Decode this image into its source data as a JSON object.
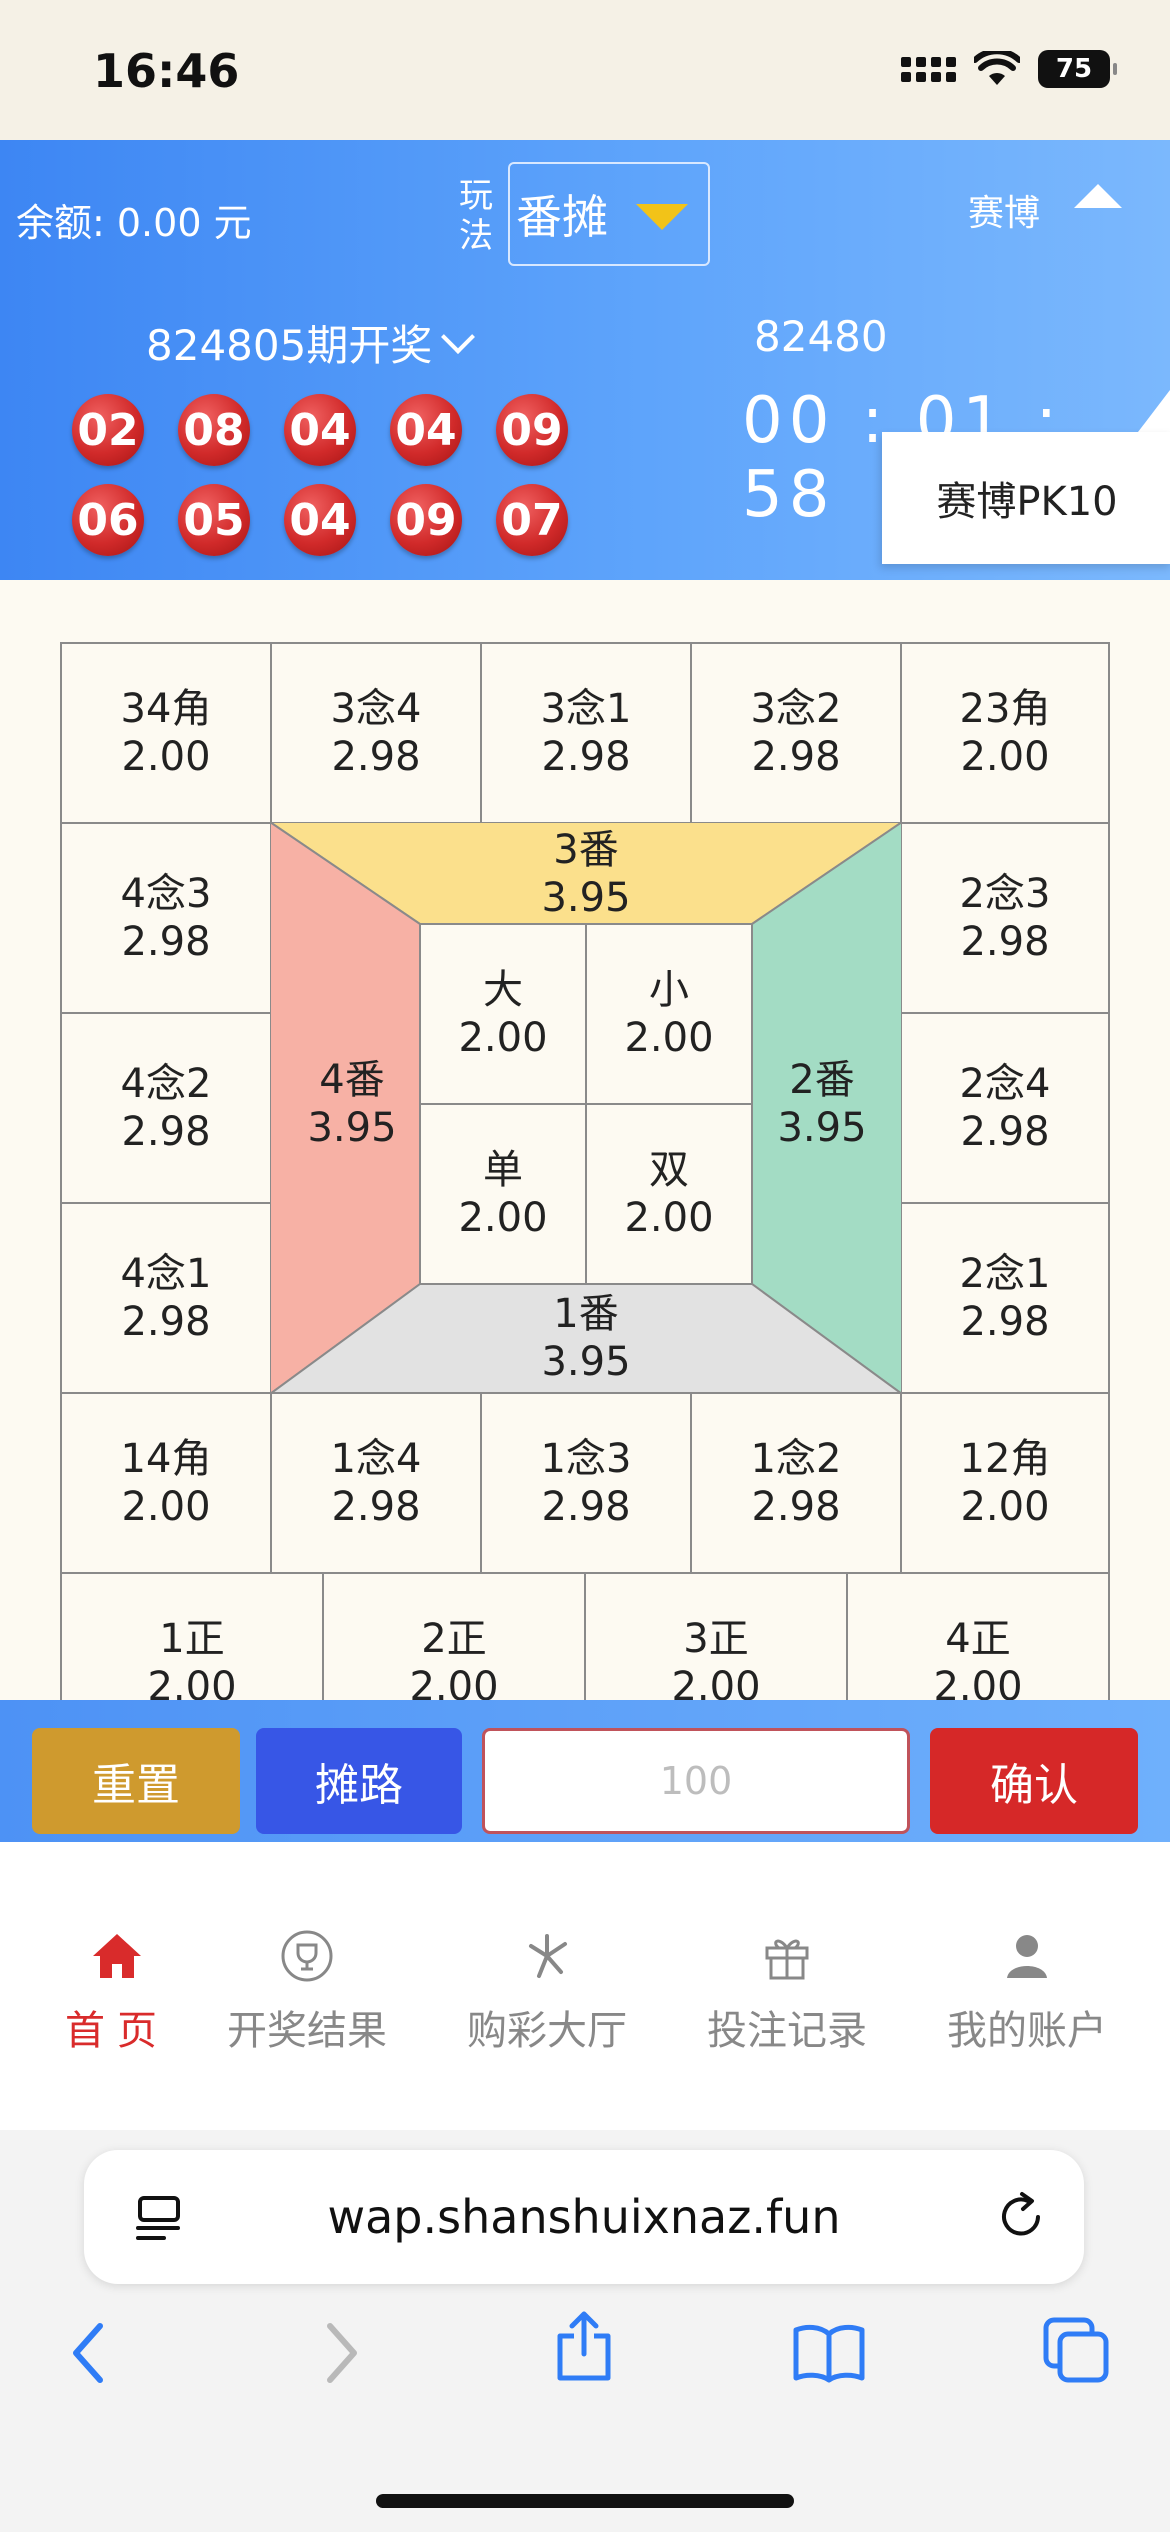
{
  "status_bar": {
    "time": "16:46",
    "battery": "75"
  },
  "header": {
    "balance": "余额: 0.00 元",
    "play_label": "玩法",
    "play_mode": "番摊",
    "game_name": "赛博",
    "last_period_label": "824805期开奖",
    "balls": [
      "02",
      "08",
      "04",
      "04",
      "09",
      "06",
      "05",
      "04",
      "09",
      "07"
    ],
    "next_period": "82480",
    "countdown": "00 : 01 : 58",
    "dropdown_option": "赛博PK10"
  },
  "board": {
    "top_row": [
      {
        "name": "34角",
        "odds": "2.00"
      },
      {
        "name": "3念4",
        "odds": "2.98"
      },
      {
        "name": "3念1",
        "odds": "2.98"
      },
      {
        "name": "3念2",
        "odds": "2.98"
      },
      {
        "name": "23角",
        "odds": "2.00"
      }
    ],
    "left_col": [
      {
        "name": "4念3",
        "odds": "2.98"
      },
      {
        "name": "4念2",
        "odds": "2.98"
      },
      {
        "name": "4念1",
        "odds": "2.98"
      }
    ],
    "right_col": [
      {
        "name": "2念3",
        "odds": "2.98"
      },
      {
        "name": "2念4",
        "odds": "2.98"
      },
      {
        "name": "2念1",
        "odds": "2.98"
      }
    ],
    "bottom_row": [
      {
        "name": "14角",
        "odds": "2.00"
      },
      {
        "name": "1念4",
        "odds": "2.98"
      },
      {
        "name": "1念3",
        "odds": "2.98"
      },
      {
        "name": "1念2",
        "odds": "2.98"
      },
      {
        "name": "12角",
        "odds": "2.00"
      }
    ],
    "fan": {
      "top": {
        "name": "3番",
        "odds": "3.95",
        "color": "#fbe08c"
      },
      "left": {
        "name": "4番",
        "odds": "3.95",
        "color": "#f7b1a5"
      },
      "right": {
        "name": "2番",
        "odds": "3.95",
        "color": "#a3dcc4"
      },
      "bottom": {
        "name": "1番",
        "odds": "3.95",
        "color": "#e2e2e2"
      }
    },
    "center": [
      {
        "name": "大",
        "odds": "2.00"
      },
      {
        "name": "小",
        "odds": "2.00"
      },
      {
        "name": "单",
        "odds": "2.00"
      },
      {
        "name": "双",
        "odds": "2.00"
      }
    ],
    "zheng_row": [
      {
        "name": "1正",
        "odds": "2.00"
      },
      {
        "name": "2正",
        "odds": "2.00"
      },
      {
        "name": "3正",
        "odds": "2.00"
      },
      {
        "name": "4正",
        "odds": "2.00"
      }
    ]
  },
  "actions": {
    "reset": "重置",
    "road": "摊路",
    "amount_placeholder": "100",
    "confirm": "确认"
  },
  "tabs": [
    {
      "label": "首页",
      "icon": "home-icon"
    },
    {
      "label": "开奖结果",
      "icon": "trophy-icon"
    },
    {
      "label": "购彩大厅",
      "icon": "lottery-icon"
    },
    {
      "label": "投注记录",
      "icon": "gift-icon"
    },
    {
      "label": "我的账户",
      "icon": "user-icon"
    }
  ],
  "browser": {
    "url": "wap.shanshuixnaz.fun"
  },
  "colors": {
    "header_blue": "#3d86f3",
    "ball_red": "#d12a2a",
    "reset": "#cf9a2e",
    "road": "#3756e6",
    "confirm": "#d62828",
    "active_tab": "#d92b2b"
  }
}
